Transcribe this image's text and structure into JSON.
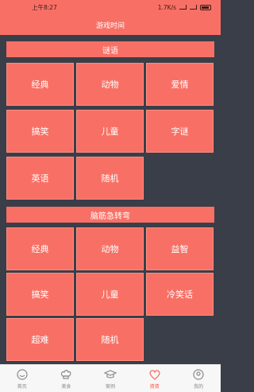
{
  "status_bar": {
    "time": "上午8:27",
    "speed": "1.7K/s"
  },
  "header": {
    "title": "游戏时间"
  },
  "sections": [
    {
      "title": "谜语",
      "items": [
        "经典",
        "动物",
        "爱情",
        "搞笑",
        "儿童",
        "字谜",
        "英语",
        "随机"
      ]
    },
    {
      "title": "脑筋急转弯",
      "items": [
        "经典",
        "动物",
        "益智",
        "搞笑",
        "儿童",
        "冷笑话",
        "超难",
        "随机"
      ]
    }
  ],
  "tabs": [
    {
      "label": "首页",
      "icon": "home-icon",
      "active": false
    },
    {
      "label": "美食",
      "icon": "chef-icon",
      "active": false
    },
    {
      "label": "案例",
      "icon": "cap-icon",
      "active": false
    },
    {
      "label": "猜猜",
      "icon": "heart-icon",
      "active": true
    },
    {
      "label": "我的",
      "icon": "user-icon",
      "active": false
    }
  ],
  "colors": {
    "accent": "#f87065",
    "background": "#3a3e48",
    "tab_inactive": "#8a8a8a"
  }
}
